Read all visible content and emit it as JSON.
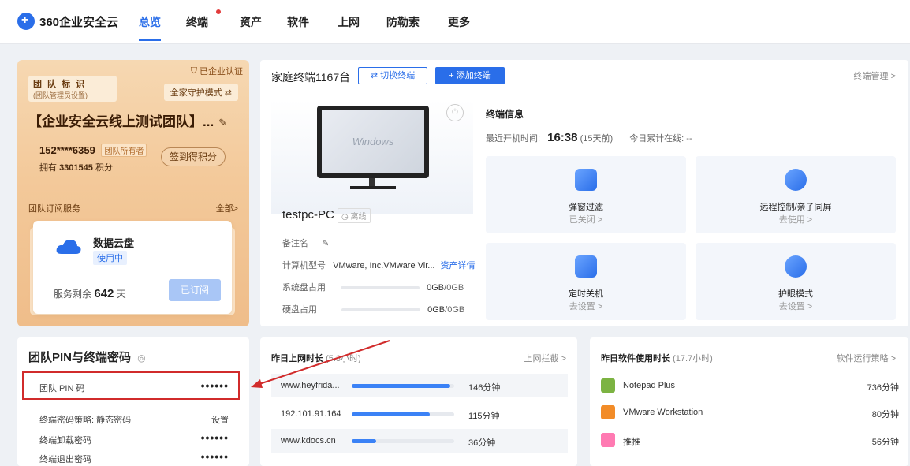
{
  "app": {
    "logo_text": "360企业安全云"
  },
  "nav": [
    {
      "label": "总览",
      "active": true
    },
    {
      "label": "终端"
    },
    {
      "label": "资产"
    },
    {
      "label": "软件"
    },
    {
      "label": "上网"
    },
    {
      "label": "防勒索"
    },
    {
      "label": "更多"
    }
  ],
  "team": {
    "certified": "已企业认证",
    "tag_title": "团 队 标 识",
    "tag_sub": "(团队管理员设置)",
    "guard_mode": "全家守护模式 ⇄",
    "name": "【企业安全云线上测试团队】...",
    "phone": "152****6359",
    "owner_tag": "团队所有者",
    "points_prefix": "拥有",
    "points_value": "3301545",
    "points_suffix": "积分",
    "signin": "签到得积分",
    "sub_title": "团队订阅服务",
    "sub_all": "全部>",
    "disk_name": "数据云盘",
    "disk_status": "使用中",
    "remain_prefix": "服务剩余",
    "remain_days": "642",
    "remain_suffix": "天",
    "subscribed": "已订阅"
  },
  "terminal": {
    "title": "家庭终端1167台",
    "switch": "⇄ 切换终端",
    "add": "+ 添加终端",
    "manage": "终端管理 >",
    "monitor_brand": "Windows",
    "pc_name": "testpc-PC",
    "status": "◷ 离线",
    "note_label": "备注名",
    "note_edit": "✎",
    "model_label": "计算机型号",
    "model_value": "VMware, Inc.VMware Vir...",
    "model_link": "资产详情",
    "sysdisk_label": "系统盘占用",
    "sysdisk_value": "0GB",
    "sysdisk_total": "/0GB",
    "disk_label": "硬盘占用",
    "disk_value": "0GB",
    "disk_total": "/0GB",
    "info_head": "终端信息",
    "boot_label": "最近开机时间:",
    "boot_time": "16:38",
    "boot_ago": "(15天前)",
    "online_label": "今日累计在线: --",
    "tiles": [
      {
        "name": "弹窗过滤",
        "status": "已关闭 >"
      },
      {
        "name": "远程控制/亲子同屏",
        "status": "去使用 >"
      },
      {
        "name": "定时关机",
        "status": "去设置 >"
      },
      {
        "name": "护眼模式",
        "status": "去设置 >"
      }
    ]
  },
  "pin": {
    "title": "团队PIN与终端密码",
    "rows": [
      {
        "label": "团队 PIN 码",
        "value": "••••••"
      },
      {
        "label": "终端密码策略: 静态密码",
        "value": "设置"
      },
      {
        "label": "终端卸载密码",
        "value": "••••••"
      },
      {
        "label": "终端退出密码",
        "value": "••••••"
      }
    ]
  },
  "net": {
    "title": "昨日上网时长",
    "title_sub": "(5.3小时)",
    "link": "上网拦截 >",
    "rows": [
      {
        "host": "www.heyfrida...",
        "minutes": "146分钟",
        "fraction": 0.96
      },
      {
        "host": "192.101.91.164",
        "minutes": "115分钟",
        "fraction": 0.76
      },
      {
        "host": "www.kdocs.cn",
        "minutes": "36分钟",
        "fraction": 0.24
      }
    ]
  },
  "software": {
    "title": "昨日软件使用时长",
    "title_sub": "(17.7小时)",
    "link": "软件运行策略 >",
    "rows": [
      {
        "name": "Notepad Plus",
        "minutes": "736分钟",
        "color": "#7cb342"
      },
      {
        "name": "VMware Workstation",
        "minutes": "80分钟",
        "color": "#f28c28"
      },
      {
        "name": "推推",
        "minutes": "56分钟",
        "color": "#ff7ab2"
      }
    ]
  }
}
